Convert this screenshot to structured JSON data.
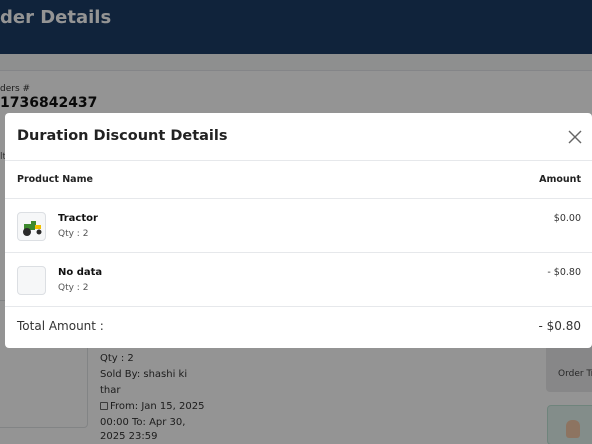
{
  "page": {
    "title": "der Details",
    "orders_label": "ders #",
    "orders_number": "1736842437",
    "side_letter": "lt",
    "item": {
      "qty": "Qty : 2",
      "sold_by_1": "Sold By: shashi ki",
      "sold_by_2": "thar",
      "from_date": "From: Jan 15, 2025",
      "time_to": "00:00 To: Apr 30,",
      "end": "2025 23:59"
    },
    "order_button_label": "Order Tr"
  },
  "modal": {
    "title": "Duration Discount Details",
    "columns": {
      "product": "Product Name",
      "amount": "Amount"
    },
    "rows": [
      {
        "name": "Tractor",
        "qty": "Qty : 2",
        "amount": "$0.00",
        "thumb": "tractor-image"
      },
      {
        "name": "No data",
        "qty": "Qty : 2",
        "amount": "- $0.80",
        "thumb": "empty-image"
      }
    ],
    "total": {
      "label": "Total Amount :",
      "value": "- $0.80"
    }
  },
  "colors": {
    "header": "#1c3d66",
    "overlay": "rgba(0,0,0,0.42)",
    "tractor": "#3e8a2e"
  }
}
